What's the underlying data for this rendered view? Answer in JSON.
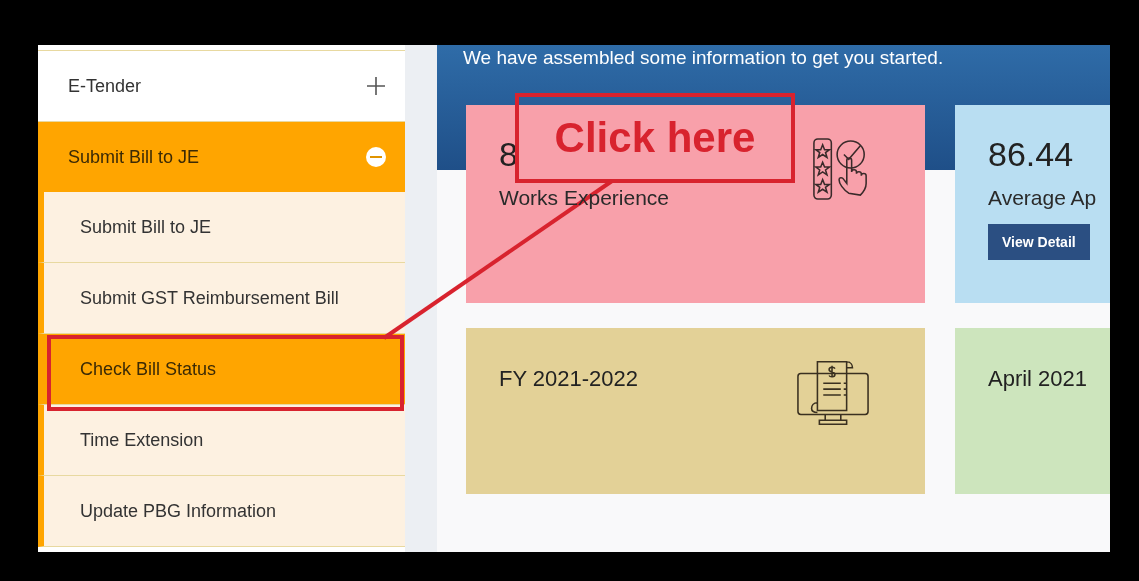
{
  "banner": {
    "text": "We have assembled some information to get you started."
  },
  "sidebar": {
    "items": [
      {
        "label": "E-Tender",
        "expanded": false
      },
      {
        "label": "Submit Bill to JE",
        "expanded": true,
        "children": [
          {
            "label": "Submit Bill to JE",
            "selected": false
          },
          {
            "label": "Submit GST Reimbursement Bill",
            "selected": false
          },
          {
            "label": "Check Bill Status",
            "selected": true
          },
          {
            "label": "Time Extension",
            "selected": false
          },
          {
            "label": "Update PBG Information",
            "selected": false
          }
        ]
      }
    ]
  },
  "cards": [
    {
      "kind": "rating",
      "value": "8",
      "label": "Works Experience",
      "color": "#f8a0aa"
    },
    {
      "kind": "plain",
      "value": "86.44",
      "label": "Average Ap",
      "button": "View Detail",
      "color": "#b9def2"
    },
    {
      "kind": "bill",
      "value": "FY 2021-2022",
      "color": "#e3d197"
    },
    {
      "kind": "plain",
      "value": "April 2021",
      "color": "#cde5bd"
    }
  ],
  "annotation": {
    "callout": "Click here"
  }
}
